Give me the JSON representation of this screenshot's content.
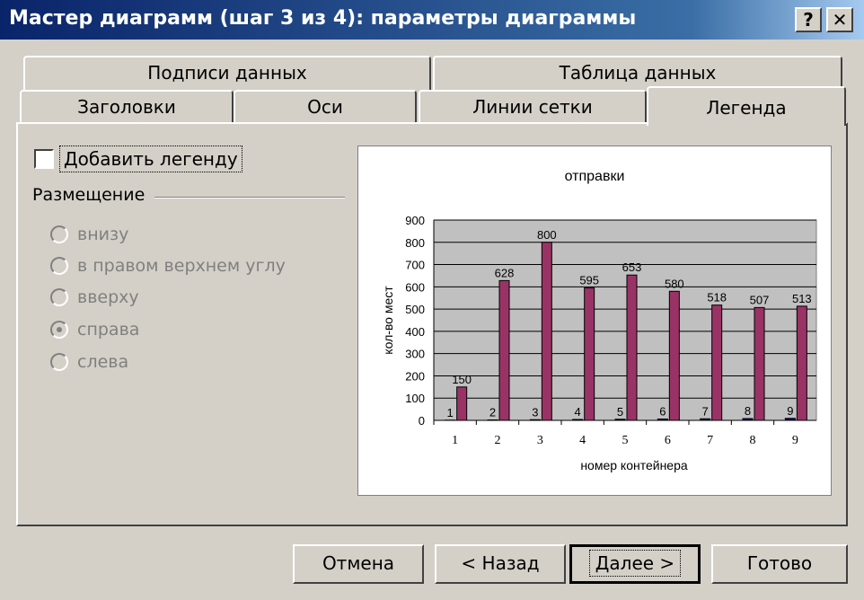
{
  "window": {
    "title": "Мастер диаграмм (шаг 3 из 4): параметры диаграммы",
    "help_button": "?",
    "close_button": "✕"
  },
  "tabs": {
    "row1": [
      "Подписи данных",
      "Таблица данных"
    ],
    "row2": [
      "Заголовки",
      "Оси",
      "Линии сетки",
      "Легенда"
    ],
    "active": "Легенда"
  },
  "legend_panel": {
    "add_legend_label": "Добавить легенду",
    "add_legend_checked": false,
    "placement_title": "Размещение",
    "placement_options": [
      "внизу",
      "в правом верхнем углу",
      "вверху",
      "справа",
      "слева"
    ],
    "selected_option": "справа",
    "options_enabled": false
  },
  "chart_data": {
    "type": "bar",
    "title": "отправки",
    "xlabel": "номер контейнера",
    "ylabel": "кол-во мест",
    "categories": [
      "1",
      "2",
      "3",
      "4",
      "5",
      "6",
      "7",
      "8",
      "9"
    ],
    "series": [
      {
        "values": [
          1,
          2,
          3,
          4,
          5,
          6,
          7,
          8,
          9
        ],
        "color": "#000080"
      },
      {
        "values": [
          150,
          628,
          800,
          595,
          653,
          580,
          518,
          507,
          513
        ],
        "color": "#993366"
      }
    ],
    "data_labels": [
      [
        "1",
        "2",
        "3",
        "4",
        "5",
        "6",
        "7",
        "8",
        "9"
      ],
      [
        "150",
        "628",
        "800",
        "595",
        "653",
        "580",
        "518",
        "507",
        "513"
      ]
    ],
    "ylim": [
      0,
      900
    ],
    "yticks": [
      0,
      100,
      200,
      300,
      400,
      500,
      600,
      700,
      800,
      900
    ],
    "plot_background": "#c0c0c0",
    "grid": true,
    "legend": "none"
  },
  "buttons": {
    "cancel": "Отмена",
    "back": "< Назад",
    "next": "Далее >",
    "finish": "Готово"
  }
}
